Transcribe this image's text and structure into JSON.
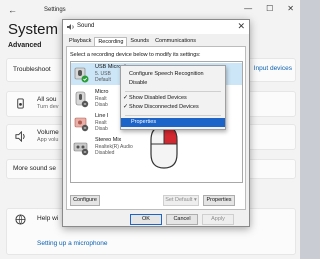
{
  "settings": {
    "app_title": "Settings",
    "page_title": "System",
    "page_subtitle": "Advanced",
    "troubleshoot": {
      "title": "Troubleshoot"
    },
    "input_devices_link": "Input devices",
    "all_sound": {
      "title": "All sou",
      "subtitle": "Turn dev"
    },
    "volume": {
      "title": "Volume",
      "subtitle": "App volu"
    },
    "more_sound": {
      "title": "More sound se"
    },
    "help": {
      "title": "Help wi"
    },
    "help_link": "Setting up a microphone"
  },
  "dialog": {
    "title": "Sound",
    "tabs": [
      "Playback",
      "Recording",
      "Sounds",
      "Communications"
    ],
    "active_tab": "Recording",
    "instruction": "Select a recording device below to modify its settings:",
    "devices": [
      {
        "name": "USB Microphone",
        "line2": "5. USB",
        "status": "Default"
      },
      {
        "name": "Micro",
        "line2": "Realt",
        "status": "Disab"
      },
      {
        "name": "Line I",
        "line2": "Realt",
        "status": "Disab"
      },
      {
        "name": "Stereo Mix",
        "line2": "Realtek(R) Audio",
        "status": "Disabled"
      }
    ],
    "configure_label": "Configure",
    "set_default_label": "Set Default",
    "properties_label": "Properties",
    "ok_label": "OK",
    "cancel_label": "Cancel",
    "apply_label": "Apply"
  },
  "context_menu": {
    "items": [
      {
        "label": "Configure Speech Recognition",
        "checked": false
      },
      {
        "label": "Disable",
        "checked": false
      },
      {
        "label": "Show Disabled Devices",
        "checked": true
      },
      {
        "label": "Show Disconnected Devices",
        "checked": true
      },
      {
        "label": "Properties",
        "checked": false,
        "highlighted": true
      }
    ]
  },
  "colors": {
    "accent": "#1c64c8",
    "link": "#0a5fb0",
    "check": "#2a9d3a"
  },
  "icons": [
    "back-arrow-icon",
    "speaker-icon",
    "microphone-icon",
    "checkmark-icon",
    "mouse-right-click-icon",
    "help-icon"
  ]
}
